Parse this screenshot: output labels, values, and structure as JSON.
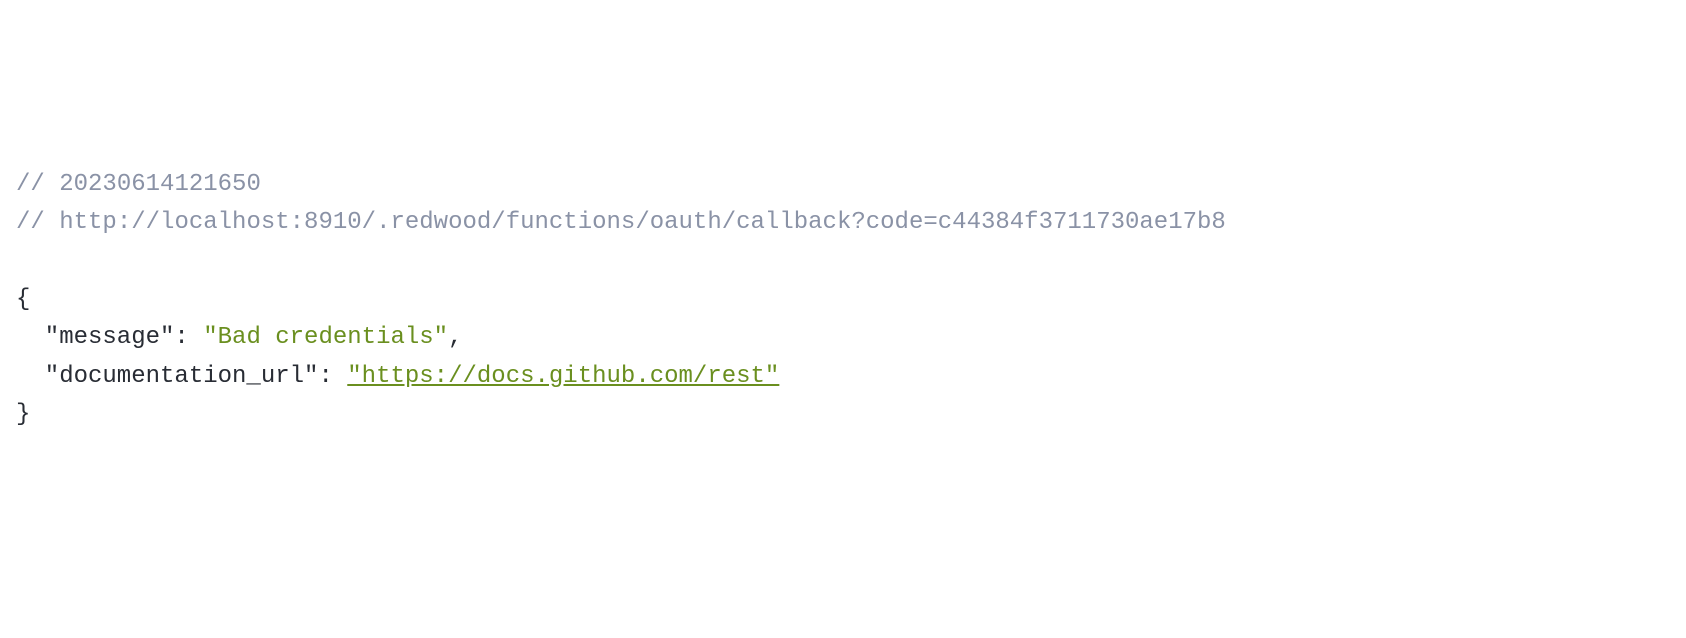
{
  "comments": {
    "timestamp_prefix": "// ",
    "timestamp": "20230614121650",
    "url_prefix": "// ",
    "url": "http://localhost:8910/.redwood/functions/oauth/callback?code=c44384f3711730ae17b8"
  },
  "json": {
    "open_brace": "{",
    "close_brace": "}",
    "keys": {
      "message": "\"message\"",
      "documentation_url": "\"documentation_url\""
    },
    "colon_space": ": ",
    "values": {
      "message": "\"Bad credentials\"",
      "documentation_url": "\"https://docs.github.com/rest\""
    },
    "comma": ",",
    "documentation_link_href": "https://docs.github.com/rest"
  }
}
